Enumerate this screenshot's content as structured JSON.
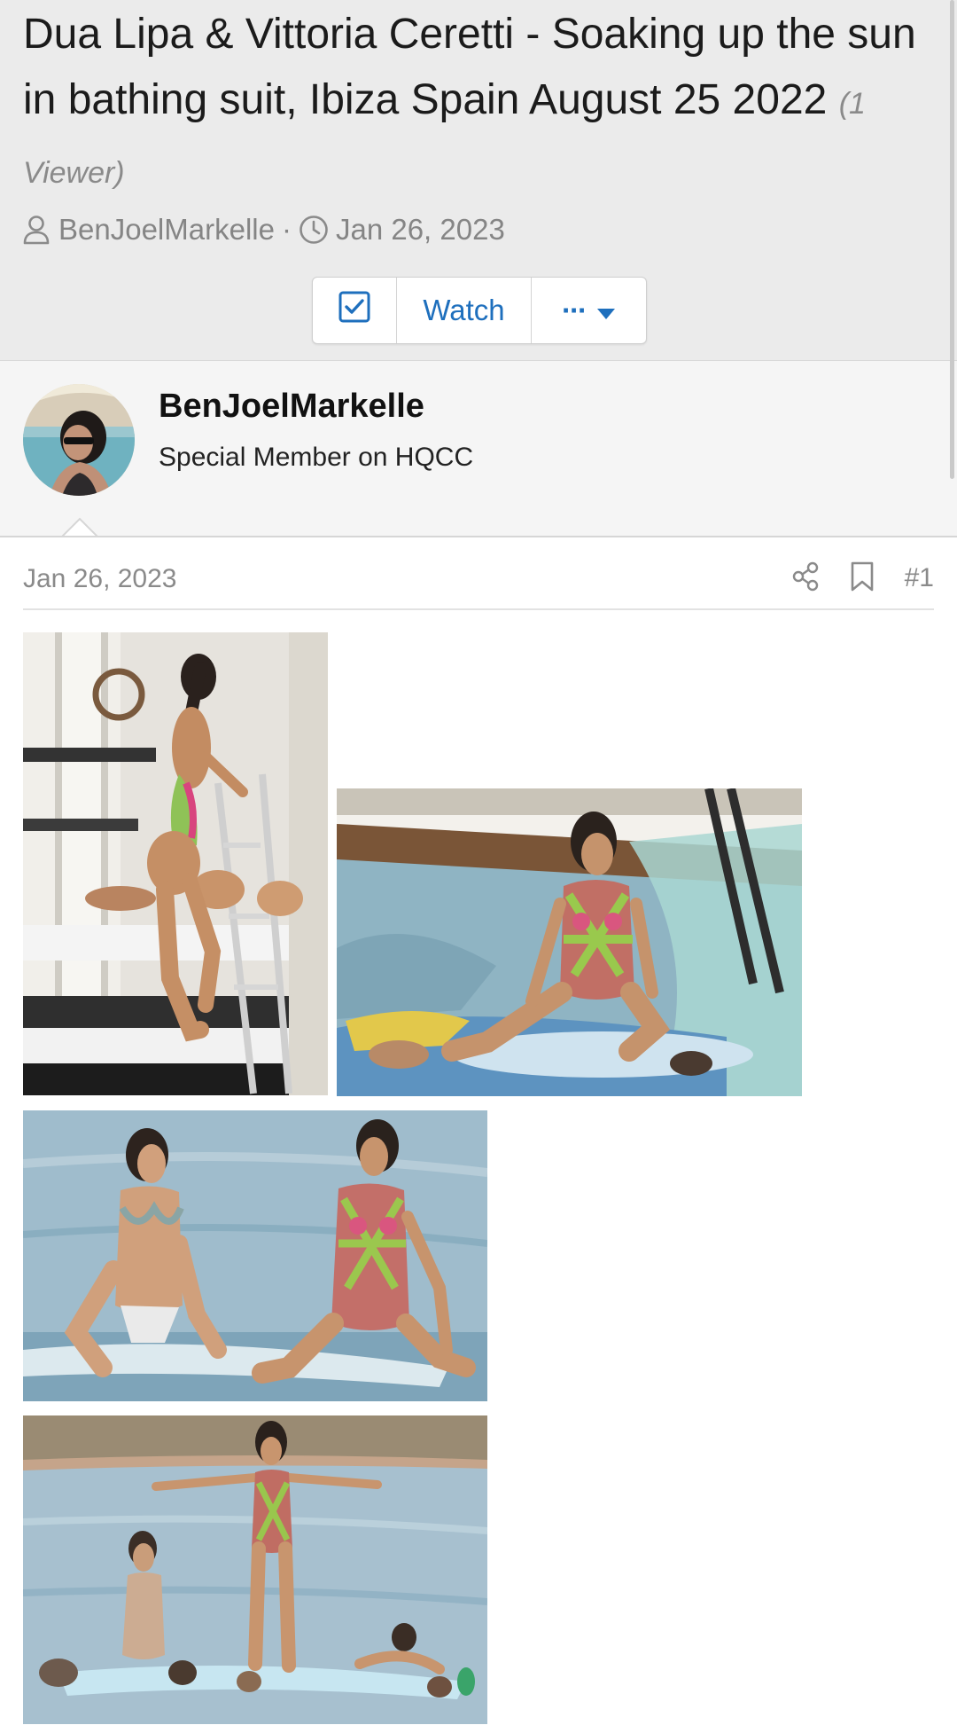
{
  "thread": {
    "title": "Dua Lipa & Vittoria Ceretti - Soaking up the sun in bathing suit, Ibiza Spain August 25 2022",
    "viewers": "(1 Viewer)",
    "starter": "BenJoelMarkelle",
    "separator": "·",
    "start_date": "Jan 26, 2023",
    "buttons": {
      "watch_label": "Watch",
      "more_label": "···"
    }
  },
  "post": {
    "author_name": "BenJoelMarkelle",
    "author_title": "Special Member on HQCC",
    "date": "Jan 26, 2023",
    "number": "#1",
    "attachments": [
      {
        "description": "photo-1"
      },
      {
        "description": "photo-2"
      },
      {
        "description": "photo-3"
      },
      {
        "description": "photo-4"
      }
    ]
  },
  "icons": {
    "user": "user-icon",
    "clock": "clock-icon",
    "check": "checkbox-icon",
    "more": "ellipsis-icon",
    "caret": "caret-down-icon",
    "share": "share-icon",
    "bookmark": "bookmark-icon"
  },
  "colors": {
    "header_bg": "#ebebeb",
    "author_bg": "#f5f5f5",
    "link_blue": "#1e6fbd",
    "muted_text": "#858585"
  }
}
